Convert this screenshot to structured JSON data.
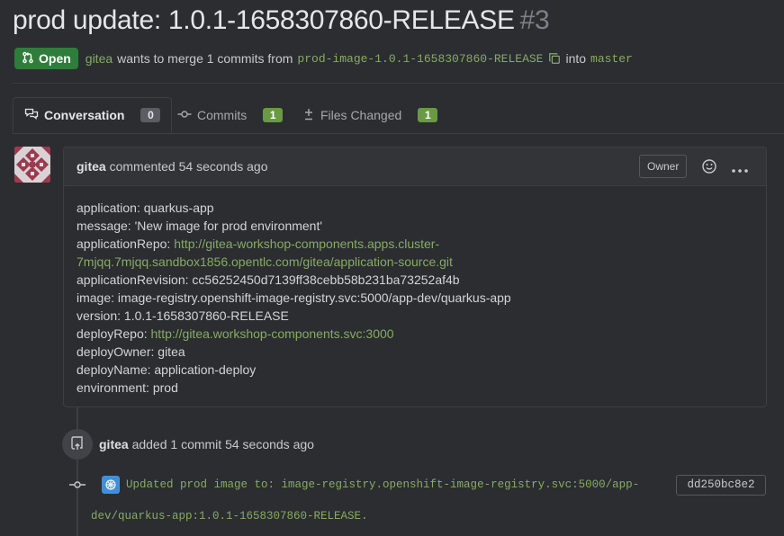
{
  "pr": {
    "title": "prod update: 1.0.1-1658307860-RELEASE",
    "number": "#3",
    "status": "Open",
    "author": "gitea",
    "merge_text": "wants to merge 1 commits from",
    "head_branch": "prod-image-1.0.1-1658307860-RELEASE",
    "into_text": "into",
    "base_branch": "master"
  },
  "tabs": [
    {
      "label": "Conversation",
      "count": "0"
    },
    {
      "label": "Commits",
      "count": "1"
    },
    {
      "label": "Files Changed",
      "count": "1"
    }
  ],
  "comment": {
    "author": "gitea",
    "action": "commented",
    "time": "54 seconds ago",
    "role_badge": "Owner",
    "lines": [
      {
        "key": "application:",
        "value": "quarkus-app"
      },
      {
        "key": "message:",
        "value": "'New image for prod environment'"
      },
      {
        "key": "applicationRepo:",
        "link1": "http://gitea-workshop-components.apps.cluster-",
        "link2": "7mjqq.7mjqq.sandbox1856.opentlc.com/gitea/application-source.git"
      },
      {
        "key": "applicationRevision:",
        "value": "cc56252450d7139ff38cebb58b231ba73252af4b"
      },
      {
        "key": "image:",
        "value": "image-registry.openshift-image-registry.svc:5000/app-dev/quarkus-app"
      },
      {
        "key": "version:",
        "value": "1.0.1-1658307860-RELEASE"
      },
      {
        "key": "deployRepo:",
        "link": "http://gitea.workshop-components.svc:3000"
      },
      {
        "key": "deployOwner:",
        "value": "gitea"
      },
      {
        "key": "deployName:",
        "value": "application-deploy"
      },
      {
        "key": "environment:",
        "value": "prod"
      }
    ]
  },
  "timeline": {
    "author": "gitea",
    "event_text": "added 1 commit",
    "time": "54 seconds ago",
    "commit_msg_line1": "Updated prod image to: image-registry.openshift-image-registry.svc:5000/app-",
    "commit_msg_line2": "dev/quarkus-app:1.0.1-1658307860-RELEASE.",
    "sha": "dd250bc8e2"
  },
  "colors": {
    "background": "#2b2d31",
    "accent_green": "#87ab63",
    "open_badge": "#2f7d3a"
  }
}
